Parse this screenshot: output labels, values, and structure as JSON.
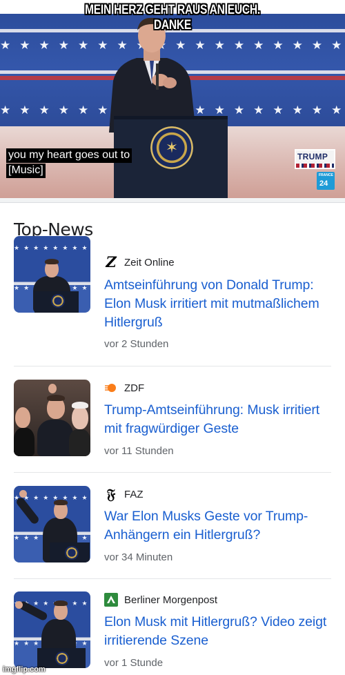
{
  "video": {
    "meme_line1": "MEIN HERZ GEHT RAUS AN EUCH.",
    "meme_line2": "DANKE",
    "caption_line1": "you my heart goes out to",
    "caption_line2": "[Music]",
    "badge_trump": "TRUMP",
    "badge_f24_small": "FRANCE",
    "badge_f24_num": "24",
    "stars": "★★★★★★★★★★★★★★★★★★★★★★"
  },
  "news": {
    "section_title": "Top-News",
    "items": [
      {
        "source_icon": "Z",
        "source": "Zeit Online",
        "headline": "Amtseinführung von Donald Trump: Elon Musk irritiert mit mutmaßlichem Hitlergruß",
        "time": "vor 2 Stunden"
      },
      {
        "source_icon": "zdf-icon",
        "source": "ZDF",
        "headline": "Trump-Amtseinführung: Musk irritiert mit fragwürdiger Geste",
        "time": "vor 11 Stunden"
      },
      {
        "source_icon": "𝔉",
        "source": "FAZ",
        "headline": "War Elon Musks Geste vor Trump-Anhängern ein Hitlergruß?",
        "time": "vor 34 Minuten"
      },
      {
        "source_icon": "morgenpost-icon",
        "source": "Berliner Morgenpost",
        "headline": "Elon Musk mit Hitlergruß? Video zeigt irritierende Szene",
        "time": "vor 1 Stunde"
      }
    ]
  },
  "watermark": "imgflip.com",
  "colors": {
    "link": "#1a5fd0",
    "meta": "#5f6368",
    "stage_blue": "#2d4d9c"
  }
}
